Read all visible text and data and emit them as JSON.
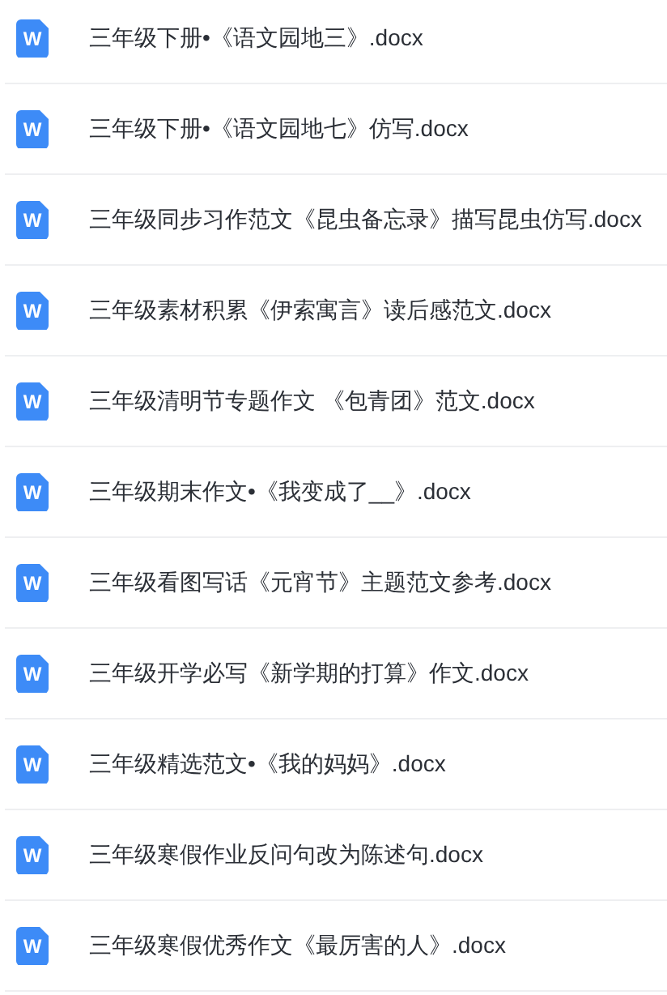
{
  "files": [
    {
      "icon_label": "W",
      "name": "三年级下册•《语文园地三》.docx"
    },
    {
      "icon_label": "W",
      "name": "三年级下册•《语文园地七》仿写.docx"
    },
    {
      "icon_label": "W",
      "name": "三年级同步习作范文《昆虫备忘录》描写昆虫仿写.docx"
    },
    {
      "icon_label": "W",
      "name": "三年级素材积累《伊索寓言》读后感范文.docx"
    },
    {
      "icon_label": "W",
      "name": "三年级清明节专题作文 《包青团》范文.docx"
    },
    {
      "icon_label": "W",
      "name": "三年级期末作文•《我变成了__》.docx"
    },
    {
      "icon_label": "W",
      "name": "三年级看图写话《元宵节》主题范文参考.docx"
    },
    {
      "icon_label": "W",
      "name": "三年级开学必写《新学期的打算》作文.docx"
    },
    {
      "icon_label": "W",
      "name": "三年级精选范文•《我的妈妈》.docx"
    },
    {
      "icon_label": "W",
      "name": "三年级寒假作业反问句改为陈述句.docx"
    },
    {
      "icon_label": "W",
      "name": "三年级寒假优秀作文《最厉害的人》.docx"
    }
  ]
}
